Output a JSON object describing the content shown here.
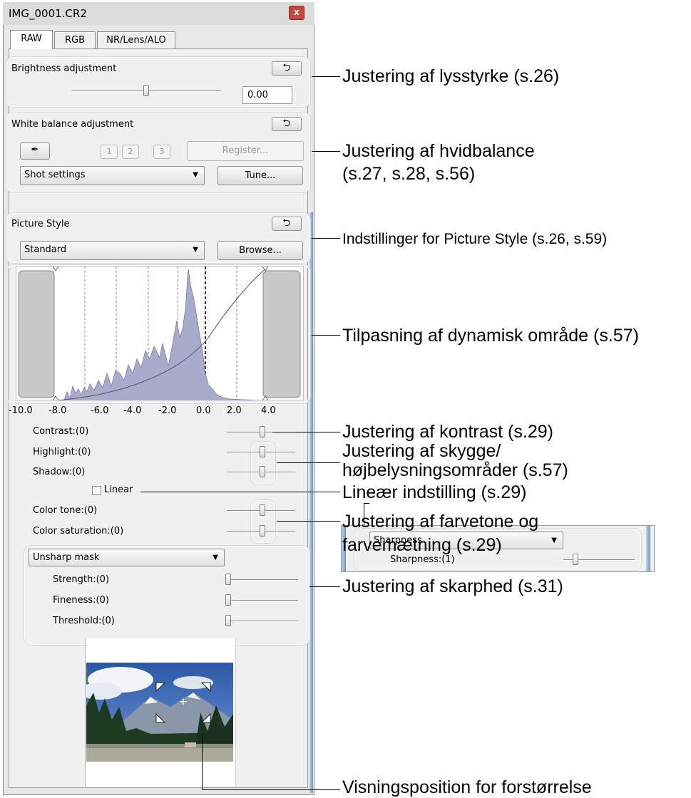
{
  "window": {
    "title": "IMG_0001.CR2",
    "close_glyph": "x"
  },
  "tabs": [
    {
      "label": "RAW",
      "active": true
    },
    {
      "label": "RGB",
      "active": false
    },
    {
      "label": "NR/Lens/ALO",
      "active": false
    }
  ],
  "brightness": {
    "header": "Brightness adjustment",
    "reset_icon": "undo-arrow-icon",
    "value": "0.00",
    "slider_fraction": 0.5
  },
  "white_balance": {
    "header": "White balance adjustment",
    "eyedropper_icon": "eyedropper-icon",
    "slots": [
      "1",
      "2",
      "3"
    ],
    "register_label": "Register...",
    "preset": "Shot settings",
    "tune_label": "Tune..."
  },
  "picture_style": {
    "header": "Picture Style",
    "style": "Standard",
    "browse_label": "Browse..."
  },
  "histogram": {
    "ticks": [
      "-10.0",
      "-8.0",
      "-6.0",
      "-4.0",
      "-2.0",
      "0.0",
      "2.0",
      "4.0"
    ],
    "fill_color": "#aaaacd",
    "handle_color": "#c8c8c8"
  },
  "tone": {
    "contrast": "Contrast:(0)",
    "highlight": "Highlight:(0)",
    "shadow": "Shadow:(0)",
    "linear": "Linear",
    "color_tone": "Color tone:(0)",
    "color_saturation": "Color saturation:(0)"
  },
  "sharpening": {
    "mode": "Unsharp mask",
    "strength": "Strength:(0)",
    "fineness": "Fineness:(0)",
    "threshold": "Threshold:(0)"
  },
  "inset": {
    "mode": "Sharpness",
    "sharpness": "Sharpness:(1)"
  },
  "annotations": {
    "brightness": "Justering af lysstyrke (s.26)",
    "wb_line1": "Justering af hvidbalance",
    "wb_line2": "(s.27, s.28, s.56)",
    "ps_main": "Indstillinger for Picture Style",
    "ps_pages": " (s.26, s.59)",
    "dynamic_range": "Tilpasning af dynamisk område (s.57)",
    "contrast": "Justering af kontrast (s.29)",
    "shadow_line1": "Justering af skygge/",
    "shadow_line2": "højbelysningsområder (s.57)",
    "linear": "Lineær indstilling (s.29)",
    "color_line1": "Justering af farvetone og",
    "color_line2": "farvemætning (s.29)",
    "sharpness": "Justering af skarphed (s.31)",
    "zoom": "Visningsposition for forstørrelse"
  }
}
